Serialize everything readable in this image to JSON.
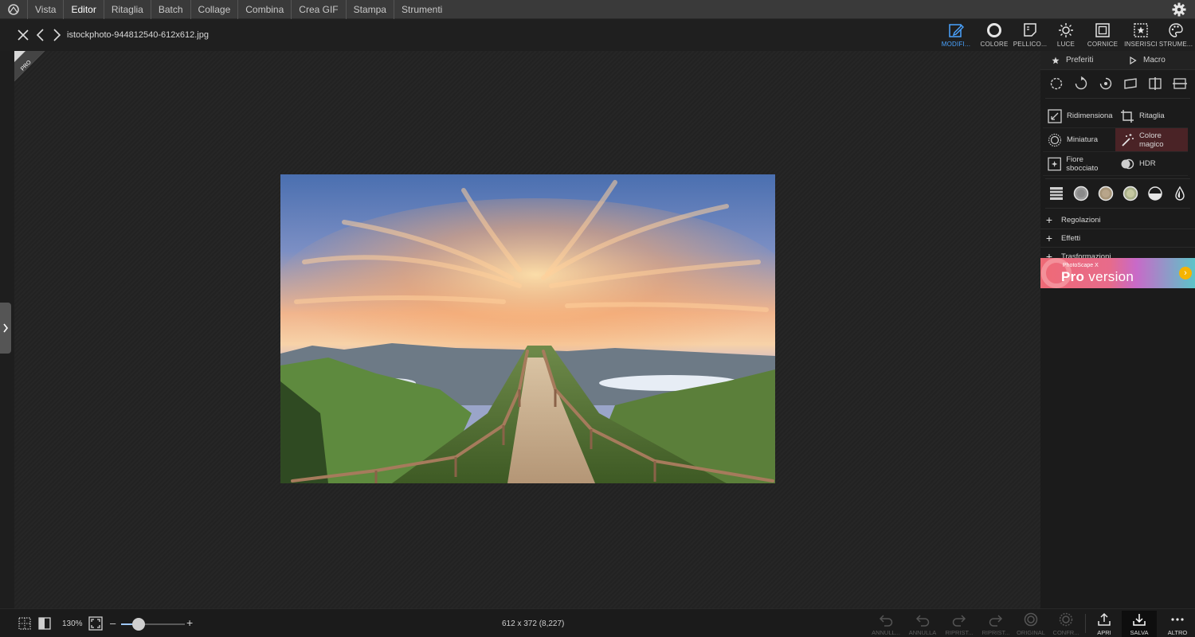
{
  "menubar": {
    "logo_icon": "phototscape-logo-icon",
    "items": [
      {
        "label": "Vista"
      },
      {
        "label": "Editor"
      },
      {
        "label": "Ritaglia"
      },
      {
        "label": "Batch"
      },
      {
        "label": "Collage"
      },
      {
        "label": "Combina"
      },
      {
        "label": "Crea GIF"
      },
      {
        "label": "Stampa"
      },
      {
        "label": "Strumenti"
      }
    ],
    "active_index": 1,
    "settings_icon": "gear-icon"
  },
  "toolbar": {
    "filename": "istockphoto-944812540-612x612.jpg",
    "tools": [
      {
        "label": "MODIFI...",
        "icon": "edit-icon",
        "active": true
      },
      {
        "label": "COLORE",
        "icon": "color-circle-icon"
      },
      {
        "label": "PELLICO...",
        "icon": "film-icon"
      },
      {
        "label": "LUCE",
        "icon": "sun-icon"
      },
      {
        "label": "CORNICE",
        "icon": "frame-icon"
      },
      {
        "label": "INSERISCI",
        "icon": "insert-star-icon"
      },
      {
        "label": "STRUME...",
        "icon": "palette-icon"
      }
    ],
    "accent": "#4aa3ff"
  },
  "panel": {
    "tabs": [
      {
        "label": "Preferiti",
        "icon": "star-icon"
      },
      {
        "label": "Macro",
        "icon": "play-icon"
      }
    ],
    "transform_icons": [
      "rotate-left-icon",
      "rotate-right-icon",
      "rotate-free-icon",
      "straighten-icon",
      "flip-horizontal-icon",
      "flip-vertical-icon"
    ],
    "tools": [
      {
        "label": "Ridimensiona",
        "icon": "resize-icon"
      },
      {
        "label": "Ritaglia",
        "icon": "crop-icon"
      },
      {
        "label": "Miniatura",
        "icon": "miniature-icon"
      },
      {
        "label": "Colore magico",
        "icon": "magic-wand-icon",
        "highlight": true
      },
      {
        "label": "Fiore sbocciato",
        "icon": "bloom-icon"
      },
      {
        "label": "HDR",
        "icon": "hdr-icon"
      }
    ],
    "filter_icons": [
      "levels-icon",
      "vignette-icon-1",
      "vignette-icon-2",
      "vignette-icon-3",
      "half-circle-icon",
      "drop-icon"
    ],
    "sections": [
      {
        "label": "Regolazioni"
      },
      {
        "label": "Effetti"
      },
      {
        "label": "Trasformazioni"
      }
    ],
    "promo": {
      "small": "PhotoScape X",
      "big_bold": "Pro",
      "big_rest": " version"
    }
  },
  "statusbar": {
    "zoom": "130%",
    "dimensions": "612 x 372 (8,227)",
    "actions": [
      {
        "label": "ANNULL...",
        "icon": "undo-all-icon",
        "enabled": false
      },
      {
        "label": "ANNULLA",
        "icon": "undo-icon",
        "enabled": false
      },
      {
        "label": "RIPRIST...",
        "icon": "redo-icon",
        "enabled": false
      },
      {
        "label": "RIPRIST...",
        "icon": "redo-all-icon",
        "enabled": false
      },
      {
        "label": "ORIGINAL",
        "icon": "original-icon",
        "enabled": false
      },
      {
        "label": "CONFR...",
        "icon": "compare-icon",
        "enabled": false
      },
      {
        "label": "APRI",
        "icon": "open-icon",
        "enabled": true
      },
      {
        "label": "SALVA",
        "icon": "save-icon",
        "enabled": true
      },
      {
        "label": "ALTRO",
        "icon": "more-icon",
        "enabled": true
      }
    ],
    "zoom_slider_fraction": 0.28
  }
}
